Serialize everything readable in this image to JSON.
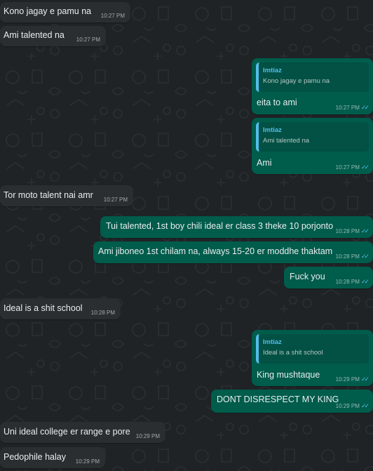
{
  "chat": {
    "messages": [
      {
        "text": "Kono jagay e pamu na",
        "time": "10:27 PM"
      },
      {
        "text": "Ami talented na",
        "time": "10:27 PM"
      },
      {
        "text": "eita to ami",
        "time": "10:27 PM",
        "reply_author": "Imtiaz",
        "reply_text": "Kono jagay e pamu na"
      },
      {
        "text": "Ami",
        "time": "10:27 PM",
        "reply_author": "Imtiaz",
        "reply_text": "Ami talented na"
      },
      {
        "text": "Tor moto talent nai amr",
        "time": "10:27 PM"
      },
      {
        "text": "Tui talented, 1st boy chili ideal er class 3 theke 10 porjonto",
        "time": "10:28 PM"
      },
      {
        "text": "Ami jiboneo 1st chilam na, always 15-20 er moddhe thaktam",
        "time": "10:28 PM"
      },
      {
        "text": "Fuck you",
        "time": "10:28 PM"
      },
      {
        "text": "Ideal is a shit school",
        "time": "10:28 PM"
      },
      {
        "text": "King mushtaque",
        "time": "10:29 PM",
        "reply_author": "Imtiaz",
        "reply_text": "Ideal is a shit school"
      },
      {
        "text": "DONT DISRESPECT MY KING",
        "time": "10:29 PM"
      },
      {
        "text": "Uni ideal college er range e pore",
        "time": "10:29 PM"
      },
      {
        "text": "Pedophile halay",
        "time": "10:29 PM"
      }
    ],
    "read_ticks": "✓✓"
  },
  "colors": {
    "incoming_bubble": "#2b2e30",
    "outgoing_bubble": "#005c4b",
    "quote_bar": "#53bdeb",
    "wallpaper": "#1f2326"
  },
  "icons": [
    "double-check-icon"
  ]
}
